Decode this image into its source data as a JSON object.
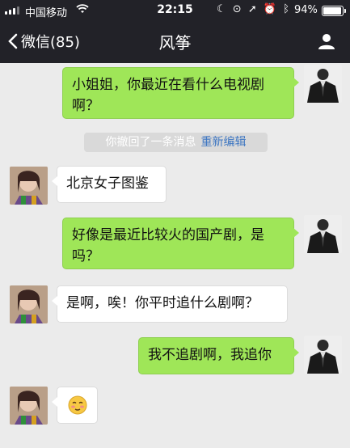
{
  "status_bar": {
    "carrier": "中国移动",
    "time": "22:15",
    "battery": "94%",
    "battery_level": 0.94
  },
  "nav": {
    "back_label": "微信(85)",
    "title": "风筝"
  },
  "messages": [
    {
      "side": "me",
      "text": "小姐姐，你最近在看什么电视剧啊？"
    },
    {
      "side": "them",
      "text": "北京女子图鉴"
    },
    {
      "side": "me",
      "text": "好像是最近比较火的国产剧，是吗？"
    },
    {
      "side": "them",
      "text": "是啊，唉！你平时追什么剧啊？"
    },
    {
      "side": "me",
      "text": "我不追剧啊，我追你"
    },
    {
      "side": "them",
      "emoji": "blushing-face"
    }
  ],
  "recall_notice": {
    "text": "你撤回了一条消息",
    "action": "重新编辑"
  },
  "colors": {
    "my_bubble": "#9fe658",
    "their_bubble": "#ffffff",
    "background": "#ebebeb",
    "header": "#222228",
    "link": "#3f77c2"
  }
}
